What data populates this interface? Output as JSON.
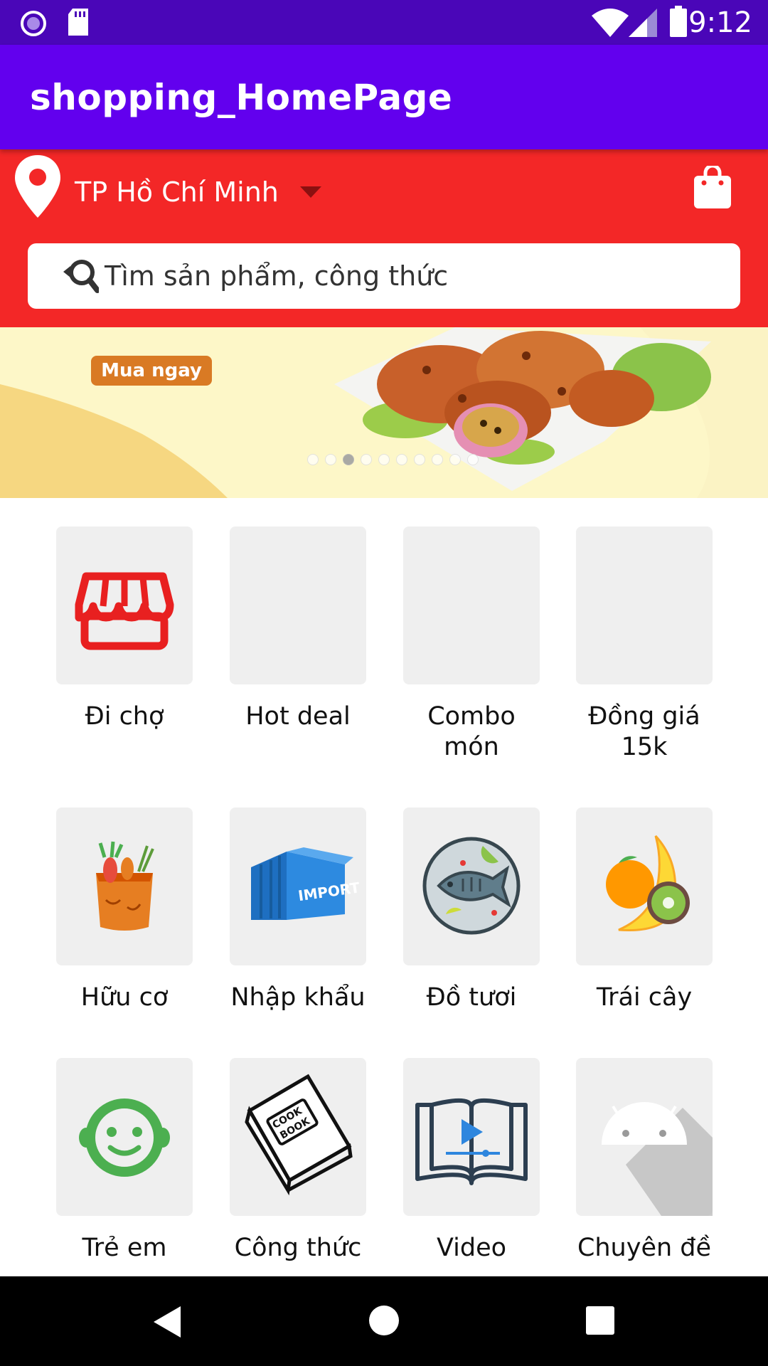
{
  "status_bar": {
    "time": "9:12"
  },
  "app_bar": {
    "title": "shopping_HomePage"
  },
  "header": {
    "location": "TP Hồ Chí Minh",
    "search_placeholder": "Tìm sản phẩm, công thức"
  },
  "banner": {
    "badge": "Mua ngay",
    "slide_count": 10,
    "active_slide": 3
  },
  "categories": [
    {
      "label": "Đi chợ",
      "icon": "store-icon"
    },
    {
      "label": "Hot deal",
      "icon": ""
    },
    {
      "label": "Combo\nmón",
      "icon": ""
    },
    {
      "label": "Đồng giá\n15k",
      "icon": ""
    },
    {
      "label": "Hữu cơ",
      "icon": "vegetable-bag-icon"
    },
    {
      "label": "Nhập khẩu",
      "icon": "import-container-icon"
    },
    {
      "label": "Đồ tươi",
      "icon": "fish-plate-icon"
    },
    {
      "label": "Trái cây",
      "icon": "fruits-icon"
    },
    {
      "label": "Trẻ em",
      "icon": "baby-face-icon"
    },
    {
      "label": "Công thức",
      "icon": "cookbook-icon"
    },
    {
      "label": "Video",
      "icon": "video-book-icon"
    },
    {
      "label": "Chuyên đề",
      "icon": "android-icon"
    }
  ],
  "colors": {
    "status_bar": "#4a06b8",
    "app_bar": "#6200ee",
    "header": "#f32727",
    "tile": "#efefef"
  }
}
